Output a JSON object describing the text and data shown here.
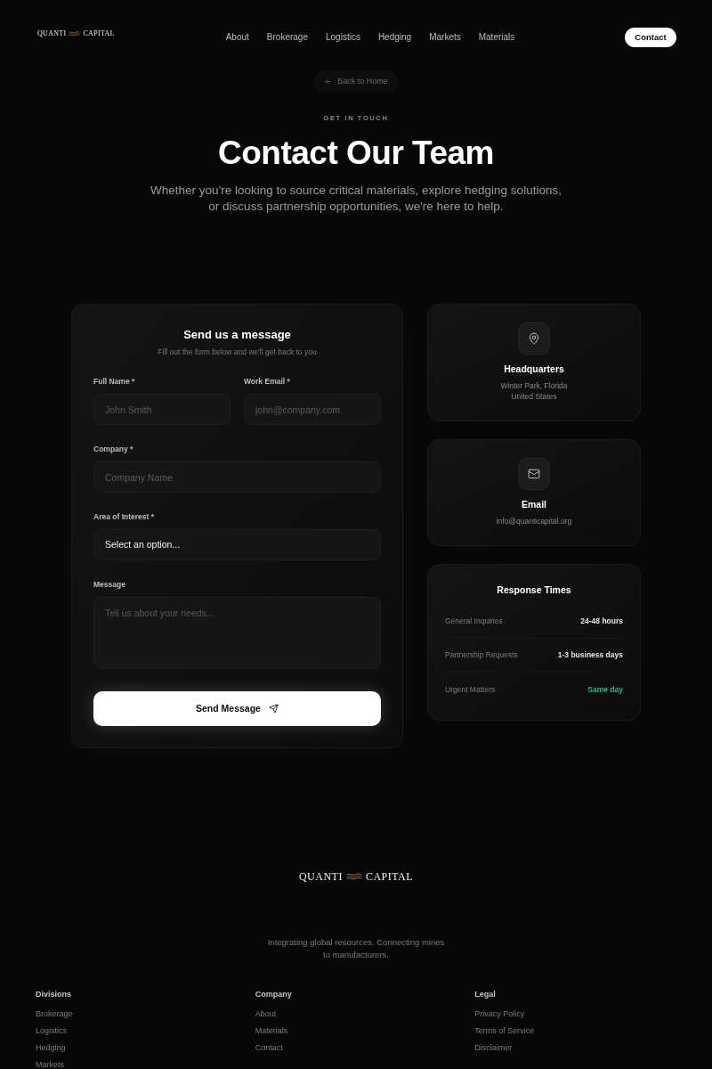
{
  "nav": {
    "logo": [
      "QUANTI",
      "CAPITAL"
    ],
    "links": [
      "About",
      "Brokerage",
      "Logistics",
      "Hedging",
      "Markets",
      "Materials"
    ],
    "cta": "Contact"
  },
  "hero": {
    "back_link": "Back to Home",
    "eyebrow": "GET IN TOUCH",
    "title": "Contact Our Team",
    "subtitle": "Whether you're looking to source critical materials, explore hedging solutions, or discuss partnership opportunities, we're here to help."
  },
  "form": {
    "title": "Send us a message",
    "subtitle": "Fill out the form below and we'll get back to you",
    "rows": [
      [
        {
          "kind": "text",
          "label": "Full Name *",
          "placeholder": "John Smith"
        },
        {
          "kind": "email",
          "label": "Work Email *",
          "placeholder": "john@company.com"
        }
      ],
      [
        {
          "kind": "text",
          "label": "Company *",
          "placeholder": "Company Name"
        }
      ],
      [
        {
          "kind": "select",
          "label": "Area of Interest *",
          "value": "Select an option..."
        }
      ],
      [
        {
          "kind": "textarea",
          "label": "Message",
          "placeholder": "Tell us about your needs..."
        }
      ]
    ],
    "submit": "Send Message"
  },
  "info_cards": [
    {
      "kind": "location",
      "title": "Headquarters",
      "lines": [
        "Winter Park, Florida",
        "United States"
      ]
    },
    {
      "kind": "email",
      "title": "Email",
      "lines": [
        "info@quanticapital.org"
      ]
    }
  ],
  "response_times": {
    "title": "Response Times",
    "rows": [
      {
        "label": "General Inquiries",
        "value": "24-48 hours",
        "color": "#e5e5e5"
      },
      {
        "label": "Partnership Requests",
        "value": "1-3 business days",
        "color": "#e5e5e5"
      },
      {
        "label": "Urgent Matters",
        "value": "Same day",
        "color": "#34b47e"
      }
    ]
  },
  "footer": {
    "logo": [
      "QUANTI",
      "CAPITAL"
    ],
    "tagline": "Integrating global resources. Connecting mines to manufacturers.",
    "columns": [
      {
        "heading": "Divisions",
        "links": [
          "Brokerage",
          "Logistics",
          "Hedging",
          "Markets"
        ]
      },
      {
        "heading": "Company",
        "links": [
          "About",
          "Materials",
          "Contact"
        ]
      },
      {
        "heading": "Legal",
        "links": [
          "Privacy Policy",
          "Terms of Service",
          "Disclaimer"
        ]
      }
    ]
  }
}
